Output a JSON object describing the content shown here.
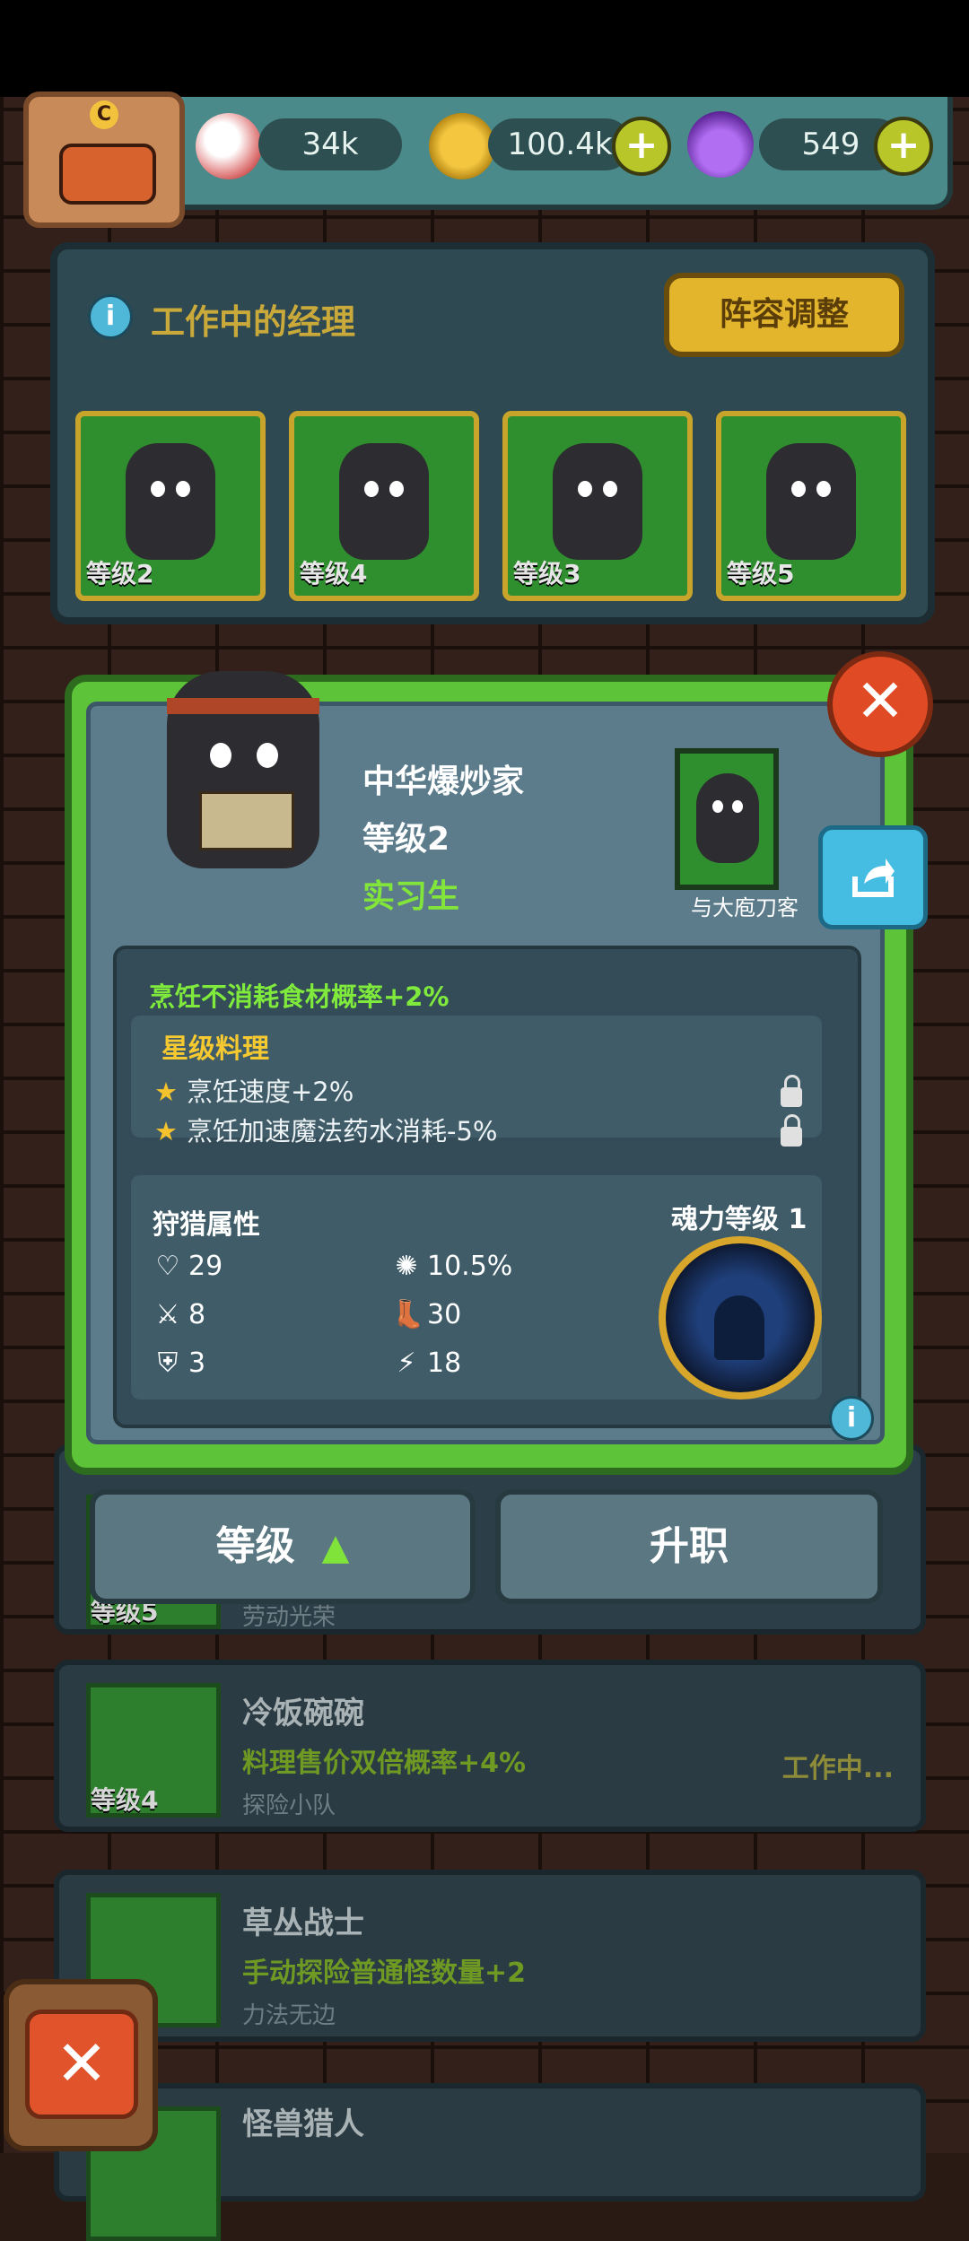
{
  "resources": {
    "eyes": "34k",
    "coins": "100.4k",
    "potions": "549",
    "rank_badge": "C"
  },
  "managers_panel": {
    "title": "工作中的经理",
    "button": "阵容调整",
    "slots": [
      {
        "level": "等级2"
      },
      {
        "level": "等级4"
      },
      {
        "level": "等级3"
      },
      {
        "level": "等级5"
      }
    ]
  },
  "list": [
    {
      "level": "等级5",
      "name": "",
      "perk": "",
      "sub": "劳动光荣",
      "state": ""
    },
    {
      "level": "等级4",
      "name": "冷饭碗碗",
      "perk": "料理售价双倍概率+4%",
      "sub": "探险小队",
      "state": "工作中..."
    },
    {
      "level": "",
      "name": "草丛战士",
      "perk": "手动探险普通怪数量+2",
      "sub": "力法无边",
      "state": ""
    },
    {
      "level": "",
      "name": "怪兽猎人",
      "perk": "",
      "sub": "",
      "state": ""
    }
  ],
  "detail": {
    "name": "中华爆炒家",
    "level": "等级2",
    "rank": "实习生",
    "partner": "与大庖刀客",
    "skill": "烹饪不消耗食材概率+2%",
    "star_title": "星级料理",
    "star_items": [
      "烹饪速度+2%",
      "烹饪加速魔法药水消耗-5%"
    ],
    "hunt_title": "狩猎属性",
    "stats": {
      "hp": "29",
      "crit": "10.5%",
      "attack": "8",
      "speed": "30",
      "defense": "3",
      "energy": "18"
    },
    "soul_label": "魂力等级 1",
    "close": "✕",
    "info": "i"
  },
  "buttons": {
    "level": "等级",
    "promote": "升职",
    "exit": "✕"
  },
  "icons": {
    "close": "close-icon",
    "share": "share-icon",
    "info": "info-icon",
    "plus": "plus-icon",
    "lock": "lock-icon",
    "star": "star-icon"
  },
  "colors": {
    "accent_green": "#7fea3c",
    "gold": "#f7c930",
    "modal_border": "#5dc338"
  }
}
